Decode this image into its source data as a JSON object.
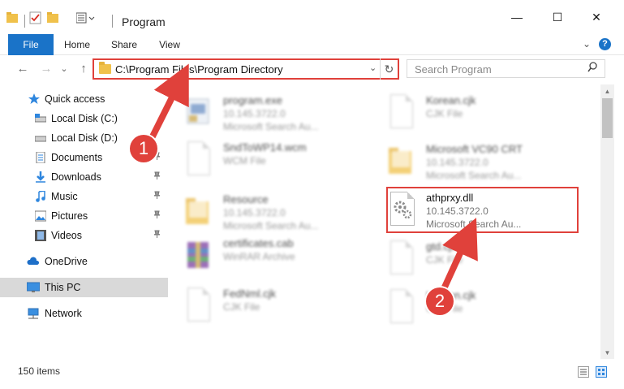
{
  "window": {
    "title": "Program",
    "minimize": "—",
    "maximize": "☐",
    "close": "✕"
  },
  "ribbon": {
    "tabs": [
      "File",
      "Home",
      "Share",
      "View"
    ],
    "expand": "⌄",
    "help": "?"
  },
  "nav": {
    "back": "←",
    "forward": "→",
    "recent": "⌄",
    "up": "↑"
  },
  "address": {
    "path": "C:\\Program Files\\Program Directory",
    "dropdown": "⌄",
    "refresh": "↻"
  },
  "search": {
    "placeholder": "Search Program",
    "icon": "⚲"
  },
  "sidebar": {
    "items": [
      {
        "label": "Quick access",
        "icon": "star-icon",
        "pinned": false
      },
      {
        "label": "Local Disk (C:)",
        "icon": "drive-icon",
        "pinned": false
      },
      {
        "label": "Local Disk (D:)",
        "icon": "drive-icon",
        "pinned": false
      },
      {
        "label": "Documents",
        "icon": "documents-icon",
        "pinned": true
      },
      {
        "label": "Downloads",
        "icon": "download-icon",
        "pinned": true
      },
      {
        "label": "Music",
        "icon": "music-icon",
        "pinned": true
      },
      {
        "label": "Pictures",
        "icon": "pictures-icon",
        "pinned": true
      },
      {
        "label": "Videos",
        "icon": "videos-icon",
        "pinned": true
      },
      {
        "label": "OneDrive",
        "icon": "cloud-icon",
        "pinned": false
      },
      {
        "label": "This PC",
        "icon": "computer-icon",
        "pinned": false,
        "selected": true
      },
      {
        "label": "Network",
        "icon": "network-icon",
        "pinned": false
      }
    ],
    "pin_glyph": "📌"
  },
  "files": [
    {
      "name": "program.exe",
      "line2": "10.145.3722.0",
      "line3": "Microsoft Search Au...",
      "icon": "exe-icon"
    },
    {
      "name": "SndToWP14.wcm",
      "line2": "WCM File",
      "line3": "",
      "icon": "file-icon"
    },
    {
      "name": "Resource",
      "line2": "10.145.3722.0",
      "line3": "Microsoft Search Au...",
      "icon": "folder-icon"
    },
    {
      "name": "certificates.cab",
      "line2": "WinRAR Archive",
      "line3": "",
      "icon": "archive-icon"
    },
    {
      "name": "FedNml.cjk",
      "line2": "CJK File",
      "line3": "",
      "icon": "file-icon"
    },
    {
      "name": "Korean.cjk",
      "line2": "CJK File",
      "line3": "",
      "icon": "file-icon"
    },
    {
      "name": "Microsoft VC90 CRT",
      "line2": "10.145.3722.0",
      "line3": "Microsoft Search Au...",
      "icon": "folder-icon"
    },
    {
      "name": "athprxy.dll",
      "line2": "10.145.3722.0",
      "line3": "Microsoft Search Au...",
      "icon": "dll-gear-icon"
    },
    {
      "name": "gtd.cjk",
      "line2": "CJK File",
      "line3": "",
      "icon": "file-icon"
    },
    {
      "name": "Korean.cjk",
      "line2": "CJK File",
      "line3": "",
      "icon": "file-icon"
    }
  ],
  "annotations": {
    "step1": "1",
    "step2": "2",
    "color": "#e0413b"
  },
  "status": {
    "count": "150 items"
  },
  "colors": {
    "accent": "#1a73c8",
    "highlight": "#e0413b",
    "folder": "#f0c14b"
  }
}
